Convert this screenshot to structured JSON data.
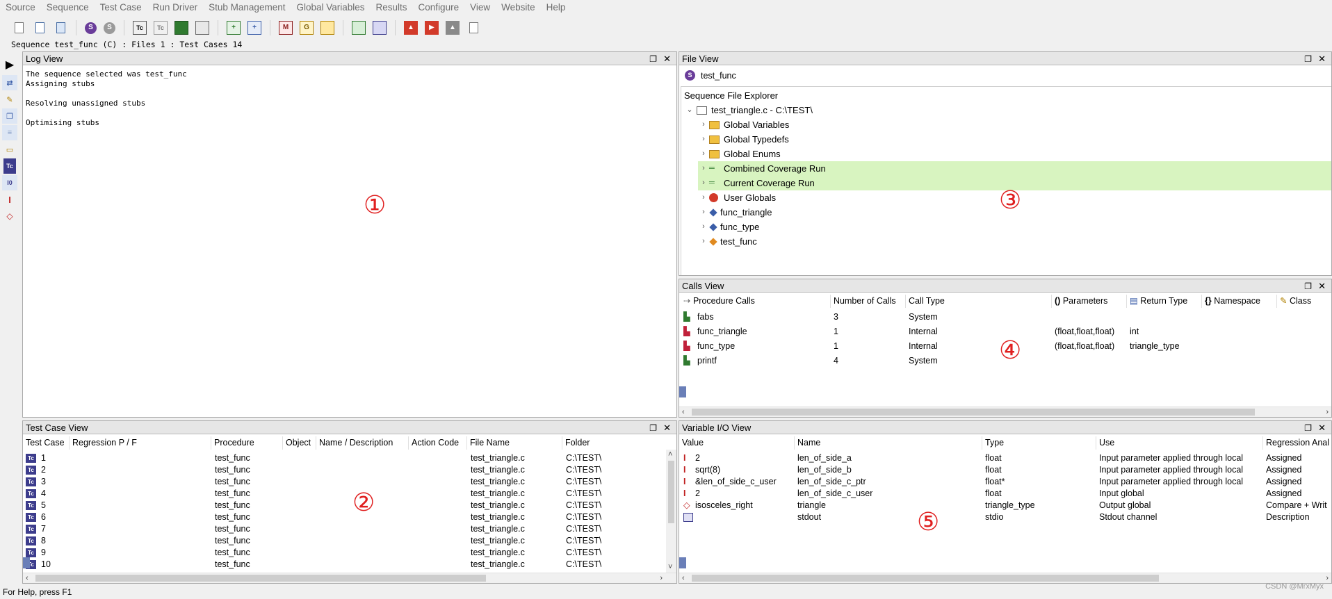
{
  "menu": [
    "Source",
    "Sequence",
    "Test Case",
    "Run Driver",
    "Stub Management",
    "Global Variables",
    "Results",
    "Configure",
    "View",
    "Website",
    "Help"
  ],
  "sequence_info": "Sequence test_func (C) : Files 1 : Test Cases 14",
  "log_view": {
    "title": "Log View",
    "lines": [
      "The sequence selected was test_func",
      "Assigning stubs",
      "",
      "Resolving unassigned stubs",
      "",
      "Optimising stubs"
    ],
    "marker": "①"
  },
  "file_view": {
    "title": "File View",
    "sequence_name": "test_func",
    "explorer_label": "Sequence File Explorer",
    "root": "test_triangle.c - C:\\TEST\\",
    "items": [
      "Global Variables",
      "Global Typedefs",
      "Global Enums",
      "Combined Coverage Run",
      "Current Coverage Run",
      "User Globals",
      "func_triangle",
      "func_type",
      "test_func"
    ],
    "marker": "③"
  },
  "calls_view": {
    "title": "Calls View",
    "headers": [
      "Procedure Calls",
      "Number of Calls",
      "Call Type",
      "Parameters",
      "Return Type",
      "Namespace",
      "Class"
    ],
    "rows": [
      {
        "proc": "fabs",
        "num": "3",
        "type": "System",
        "params": "",
        "ret": ""
      },
      {
        "proc": "func_triangle",
        "num": "1",
        "type": "Internal",
        "params": "(float,float,float)",
        "ret": "int"
      },
      {
        "proc": "func_type",
        "num": "1",
        "type": "Internal",
        "params": "(float,float,float)",
        "ret": "triangle_type"
      },
      {
        "proc": "printf",
        "num": "4",
        "type": "System",
        "params": "",
        "ret": ""
      }
    ],
    "marker": "④"
  },
  "test_case_view": {
    "title": "Test Case View",
    "headers": [
      "Test Case",
      "Regression P / F",
      "Procedure",
      "Object",
      "Name / Description",
      "Action Code",
      "File Name",
      "Folder"
    ],
    "rows": [
      {
        "id": "1",
        "proc": "test_func",
        "file": "test_triangle.c",
        "folder": "C:\\TEST\\"
      },
      {
        "id": "2",
        "proc": "test_func",
        "file": "test_triangle.c",
        "folder": "C:\\TEST\\"
      },
      {
        "id": "3",
        "proc": "test_func",
        "file": "test_triangle.c",
        "folder": "C:\\TEST\\"
      },
      {
        "id": "4",
        "proc": "test_func",
        "file": "test_triangle.c",
        "folder": "C:\\TEST\\"
      },
      {
        "id": "5",
        "proc": "test_func",
        "file": "test_triangle.c",
        "folder": "C:\\TEST\\"
      },
      {
        "id": "6",
        "proc": "test_func",
        "file": "test_triangle.c",
        "folder": "C:\\TEST\\"
      },
      {
        "id": "7",
        "proc": "test_func",
        "file": "test_triangle.c",
        "folder": "C:\\TEST\\"
      },
      {
        "id": "8",
        "proc": "test_func",
        "file": "test_triangle.c",
        "folder": "C:\\TEST\\"
      },
      {
        "id": "9",
        "proc": "test_func",
        "file": "test_triangle.c",
        "folder": "C:\\TEST\\"
      },
      {
        "id": "10",
        "proc": "test_func",
        "file": "test_triangle.c",
        "folder": "C:\\TEST\\"
      }
    ],
    "icon_label": "Tc",
    "marker": "②"
  },
  "variable_io_view": {
    "title": "Variable I/O View",
    "headers": [
      "Value",
      "Name",
      "Type",
      "Use",
      "Regression Anal"
    ],
    "rows": [
      {
        "icon": "I",
        "value": "2",
        "name": "len_of_side_a",
        "type": "float",
        "use": "Input parameter applied through local",
        "reg": "Assigned"
      },
      {
        "icon": "I",
        "value": "sqrt(8)",
        "name": "len_of_side_b",
        "type": "float",
        "use": "Input parameter applied through local",
        "reg": "Assigned"
      },
      {
        "icon": "I",
        "value": "&len_of_side_c_user",
        "name": "len_of_side_c_ptr",
        "type": "float*",
        "use": "Input parameter applied through local",
        "reg": "Assigned"
      },
      {
        "icon": "I",
        "value": "2",
        "name": "len_of_side_c_user",
        "type": "float",
        "use": "Input global",
        "reg": "Assigned"
      },
      {
        "icon": "O",
        "value": "isosceles_right",
        "name": "triangle",
        "type": "triangle_type",
        "use": "Output global",
        "reg": "Compare + Writ"
      },
      {
        "icon": "out",
        "value": "",
        "name": "stdout",
        "type": "stdio",
        "use": "Stdout channel",
        "reg": "Description"
      }
    ],
    "marker": "⑤"
  },
  "status_bar": "For Help, press F1",
  "watermark": "CSDN @MrxMyx",
  "colors": {
    "highlight": "#d8f4c0",
    "marker": "#e02020",
    "tc_icon": "#3c3c8c"
  }
}
